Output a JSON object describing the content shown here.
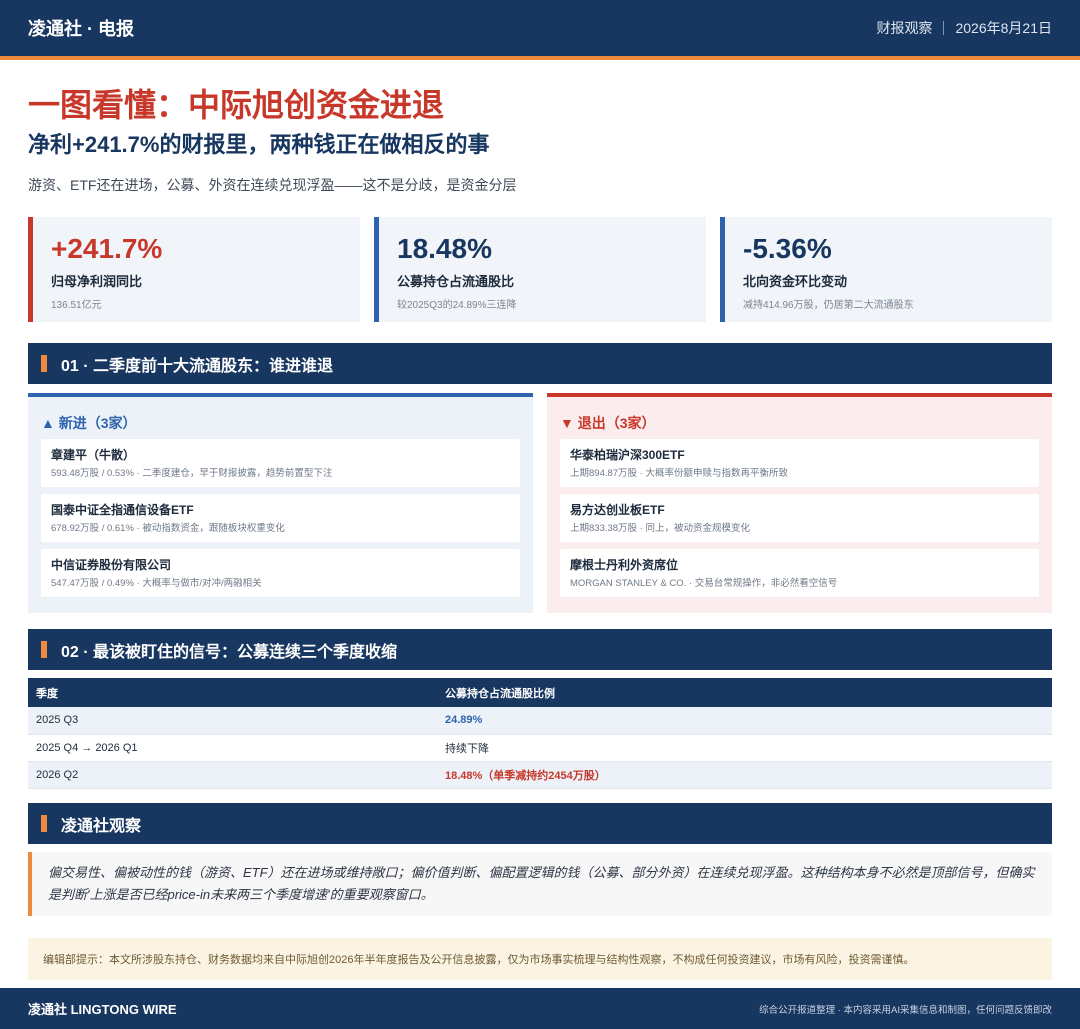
{
  "header": {
    "brand": "凌通社 · 电报",
    "section": "财报观察",
    "date": "2026年8月21日"
  },
  "headline": "一图看懂：中际旭创资金进退",
  "subhead": "净利+241.7%的财报里，两种钱正在做相反的事",
  "lede": "游资、ETF还在进场，公募、外资在连续兑现浮盈——这不是分歧，是资金分层",
  "kpis": [
    {
      "value": "+241.7%",
      "label": "归母净利润同比",
      "note": "136.51亿元",
      "color": "#c8382a"
    },
    {
      "value": "18.48%",
      "label": "公募持仓占流通股比",
      "note": "较2025Q3的24.89%三连降",
      "color": "#173660"
    },
    {
      "value": "-5.36%",
      "label": "北向资金环比变动",
      "note": "减持414.96万股，仍居第二大流通股东",
      "color": "#173660"
    }
  ],
  "section1": {
    "title": "01 · 二季度前十大流通股东：谁进谁退"
  },
  "entries_in": {
    "title": "▲ 新进（3家）",
    "items": [
      {
        "name": "章建平（牛散）",
        "detail": "593.48万股 / 0.53% · 二季度建仓，早于财报披露，趋势前置型下注"
      },
      {
        "name": "国泰中证全指通信设备ETF",
        "detail": "678.92万股 / 0.61% · 被动指数资金，跟随板块权重变化"
      },
      {
        "name": "中信证券股份有限公司",
        "detail": "547.47万股 / 0.49% · 大概率与做市/对冲/两融相关"
      }
    ]
  },
  "entries_out": {
    "title": "▼ 退出（3家）",
    "items": [
      {
        "name": "华泰柏瑞沪深300ETF",
        "detail": "上期894.87万股 · 大概率份额申赎与指数再平衡所致"
      },
      {
        "name": "易方达创业板ETF",
        "detail": "上期833.38万股 · 同上，被动资金规模变化"
      },
      {
        "name": "摩根士丹利外资席位",
        "detail": "MORGAN STANLEY & CO. · 交易台常规操作，非必然看空信号"
      }
    ]
  },
  "section2": {
    "title": "02 · 最该被盯住的信号：公募连续三个季度收缩"
  },
  "table": {
    "headers": [
      "季度",
      "公募持仓占流通股比例"
    ],
    "rows": [
      {
        "period": "2025 Q3",
        "value": "24.89%"
      },
      {
        "period": "2025 Q4 → 2026 Q1",
        "value": "持续下降"
      },
      {
        "period": "2026 Q2",
        "value": "18.48%（单季减持约2454万股）"
      }
    ]
  },
  "section3": {
    "title": "凌通社观察"
  },
  "observation": "偏交易性、偏被动性的钱（游资、ETF）还在进场或维持敞口；偏价值判断、偏配置逻辑的钱（公募、部分外资）在连续兑现浮盈。这种结构本身不必然是顶部信号，但确实是判断'上涨是否已经price-in未来两三个季度增速'的重要观察窗口。",
  "disclaimer": "编辑部提示：本文所涉股东持仓、财务数据均来自中际旭创2026年半年度报告及公开信息披露，仅为市场事实梳理与结构性观察，不构成任何投资建议，市场有风险，投资需谨慎。",
  "footer": {
    "brand": "凌通社 LINGTONG WIRE",
    "note": "综合公开报道整理 · 本内容采用AI采集信息和制图，任何问题反馈即改"
  },
  "colors": {
    "navy": "#173660",
    "accent": "#ee8a3c",
    "red": "#c8382a",
    "blue": "#2d64ad"
  }
}
